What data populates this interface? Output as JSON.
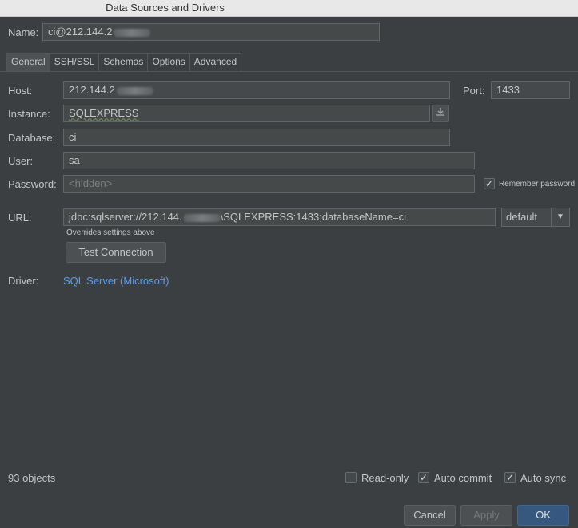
{
  "window": {
    "title": "Data Sources and Drivers"
  },
  "name": {
    "label": "Name:",
    "value_prefix": "ci@212.144.2"
  },
  "tabs": [
    "General",
    "SSH/SSL",
    "Schemas",
    "Options",
    "Advanced"
  ],
  "host": {
    "label": "Host:",
    "value_prefix": "212.144.2"
  },
  "port": {
    "label": "Port:",
    "value": "1433"
  },
  "instance": {
    "label": "Instance:",
    "value": "SQLEXPRESS"
  },
  "database": {
    "label": "Database:",
    "value": "ci"
  },
  "user": {
    "label": "User:",
    "value": "sa"
  },
  "password": {
    "label": "Password:",
    "placeholder": "<hidden>"
  },
  "remember_password": {
    "label": "Remember password",
    "checked": true
  },
  "url": {
    "label": "URL:",
    "value_prefix": "jdbc:sqlserver://212.144.",
    "value_suffix": "\\SQLEXPRESS:1433;databaseName=ci",
    "hint": "Overrides settings above",
    "mode": "default"
  },
  "test_connection": {
    "label": "Test Connection"
  },
  "driver": {
    "label": "Driver:",
    "value": "SQL Server (Microsoft)"
  },
  "status": {
    "objects": "93 objects"
  },
  "options": {
    "read_only": {
      "label": "Read-only",
      "checked": false
    },
    "auto_commit": {
      "label": "Auto commit",
      "checked": true
    },
    "auto_sync": {
      "label": "Auto sync",
      "checked": true
    }
  },
  "buttons": {
    "cancel": "Cancel",
    "apply": "Apply",
    "ok": "OK"
  },
  "icons": {
    "instance_browse": "download-icon",
    "dropdown_arrow": "chevron-down-icon",
    "checkmark": "checkmark-icon"
  }
}
